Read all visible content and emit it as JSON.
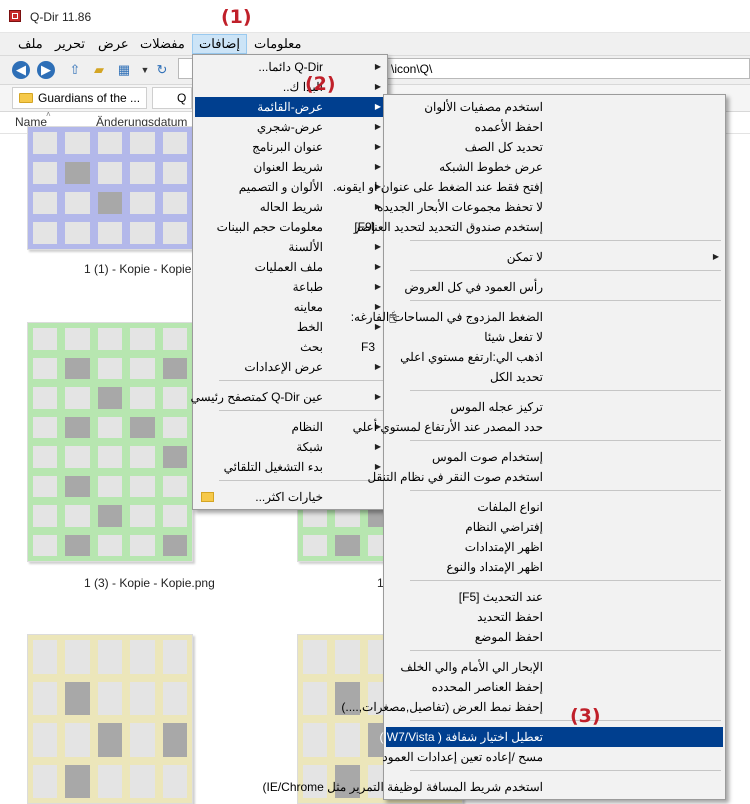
{
  "app": {
    "title": "Q-Dir 11.86"
  },
  "menubar": [
    "ملف",
    "تحرير",
    "عرض",
    "مفضلات",
    "إضافات",
    "معلومات"
  ],
  "address": {
    "path": "\\icon\\Q\\"
  },
  "tabs": [
    {
      "label": "Guardians of the ..."
    },
    {
      "label": "Q"
    }
  ],
  "columns": [
    "Name",
    "Änderungsdatum"
  ],
  "thumbnails": [
    "1 (1) - Kopie - Kopie.",
    "1 (3) - Kopie - Kopie.png",
    "1"
  ],
  "steps": [
    "(1)",
    "(2)",
    "(3)"
  ],
  "menu1": [
    {
      "label": "Q-Dir دائما...",
      "arrow": true
    },
    {
      "label": "البدا ك..",
      "arrow": true
    },
    {
      "label": "عرض-القائمة",
      "arrow": true,
      "highlight": true
    },
    {
      "label": "عرض-شجري",
      "arrow": true
    },
    {
      "label": "عنوان البرنامج",
      "arrow": true
    },
    {
      "label": "شريط العنوان",
      "arrow": true
    },
    {
      "label": "الألوان و التصميم",
      "arrow": true
    },
    {
      "label": "شريط الحاله",
      "arrow": true
    },
    {
      "label": "معلومات حجم البينات",
      "arrow": false,
      "shortcut": "[F9]"
    },
    {
      "label": "الألسنة",
      "arrow": true
    },
    {
      "label": "ملف العمليات",
      "arrow": true
    },
    {
      "label": "طباعة",
      "arrow": true
    },
    {
      "label": "معاينه",
      "arrow": true
    },
    {
      "label": "الخط",
      "arrow": true
    },
    {
      "label": "بحث",
      "arrow": false,
      "shortcut": "F3"
    },
    {
      "label": "عرض الإعدادات",
      "arrow": true
    },
    {
      "sep": true
    },
    {
      "label": "عين Q-Dir كمتصفح رئيسي",
      "arrow": true
    },
    {
      "sep": true
    },
    {
      "label": "النظام",
      "arrow": true
    },
    {
      "label": "شبكة",
      "arrow": true
    },
    {
      "label": "بدء التشغيل التلقائي",
      "arrow": true
    },
    {
      "sep": true
    },
    {
      "label": "خيارات اكثر...",
      "arrow": false,
      "folder": true
    }
  ],
  "menu2": [
    {
      "label": "استخدم مصفيات الألوان"
    },
    {
      "label": "احفظ الأعمده"
    },
    {
      "label": "تحديد كل الصف"
    },
    {
      "label": "عرض خطوط الشبكه"
    },
    {
      "label": "إفتح فقط عند الضغط على عنوان او ايقونه."
    },
    {
      "label": "لا تحفظ مجموعات الأبحار الجديده"
    },
    {
      "label": "إستخدم صندوق التحديد لتحديد العناصر"
    },
    {
      "sep": true
    },
    {
      "label": "لا تمكن",
      "arrow": true
    },
    {
      "sep": true
    },
    {
      "label": "رأس العمود في كل العروض"
    },
    {
      "sep": true
    },
    {
      "label": "الضغط المزدوج في المساحات الفارغه:",
      "mouse": true
    },
    {
      "label": "لا تفعل شيئا"
    },
    {
      "label": "اذهب الي:ارتفع مستوي اعلي"
    },
    {
      "label": "تحديد الكل"
    },
    {
      "sep": true
    },
    {
      "label": "تركيز عجله الموس"
    },
    {
      "label": "حدد المصدر عند الأرتفاع لمستوي أعلي"
    },
    {
      "sep": true
    },
    {
      "label": "إستخدام صوت الموس"
    },
    {
      "label": "استخدم صوت النقر في نظام التنقل"
    },
    {
      "sep": true
    },
    {
      "label": "انواع الملفات"
    },
    {
      "label": "إفتراضي النظام"
    },
    {
      "label": "اظهر الإمتدادات"
    },
    {
      "label": "اظهر الإمتداد والنوع"
    },
    {
      "sep": true
    },
    {
      "label": "عند التحديث [F5]"
    },
    {
      "label": "احفظ التحديد"
    },
    {
      "label": "احفظ الموضع"
    },
    {
      "sep": true
    },
    {
      "label": "الإبحار الي الأمام والي الخلف"
    },
    {
      "label": "إحفظ العناصر المحدده"
    },
    {
      "label": "إحفظ نمط العرض (تفاصيل,مصغرات,....)"
    },
    {
      "sep": true
    },
    {
      "label": "تعطيل اختيار شفافة ( W7/Vista )",
      "highlight": true
    },
    {
      "label": "مسح /إعاده تعين إعدادات العمود"
    },
    {
      "sep": true
    },
    {
      "label": "استخدم شريط المسافة لوظيفة التمرير مثل IE/Chrome)"
    }
  ]
}
